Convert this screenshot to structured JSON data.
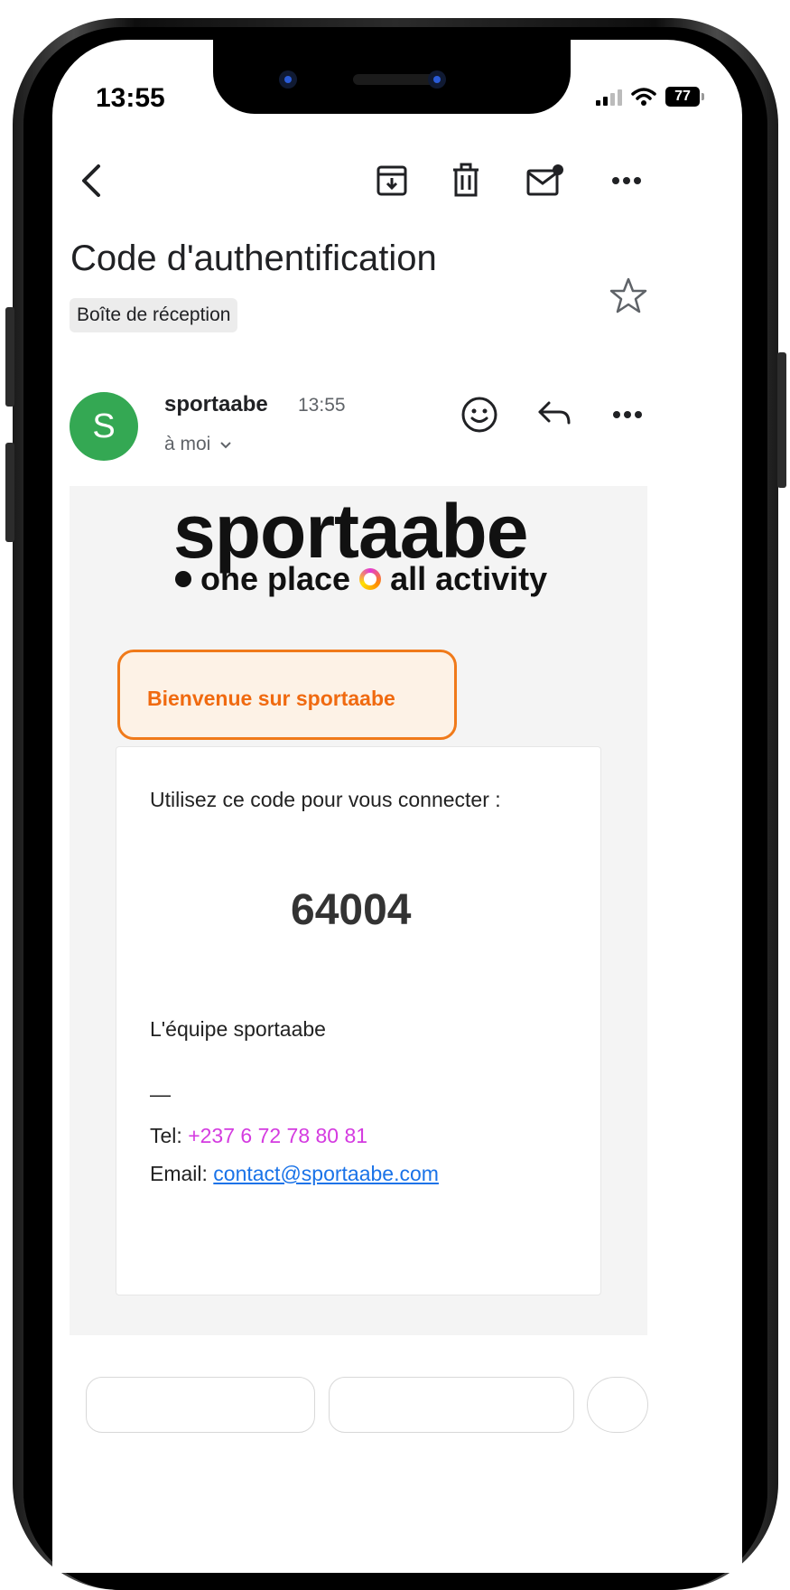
{
  "status_bar": {
    "time": "13:55",
    "battery": "77"
  },
  "toolbar": {
    "back": "back-icon",
    "archive": "archive-icon",
    "delete": "trash-icon",
    "mark_unread": "mail-unread-icon",
    "more": "more-icon"
  },
  "email": {
    "subject": "Code d'authentification",
    "label": "Boîte de réception",
    "sender": {
      "initial": "S",
      "name": "sportaabe",
      "time": "13:55",
      "recipient": "à moi"
    },
    "body": {
      "brand": "sportaabe",
      "tagline_part1": "one place",
      "tagline_part2": "all activity",
      "welcome": "Bienvenue sur sportaabe",
      "instruction": "Utilisez ce code pour vous connecter :",
      "code": "64004",
      "signature": "L'équipe sportaabe",
      "separator": "—",
      "tel_label": "Tel:",
      "tel_value": "+237 6 72 78 80 81",
      "email_label": "Email:",
      "email_value": "contact@sportaabe.com"
    }
  },
  "colors": {
    "avatar": "#34a853",
    "welcome_border": "#f07a1a",
    "welcome_text": "#f06a10",
    "phone_link": "#d43be0",
    "email_link": "#1a73e8"
  }
}
